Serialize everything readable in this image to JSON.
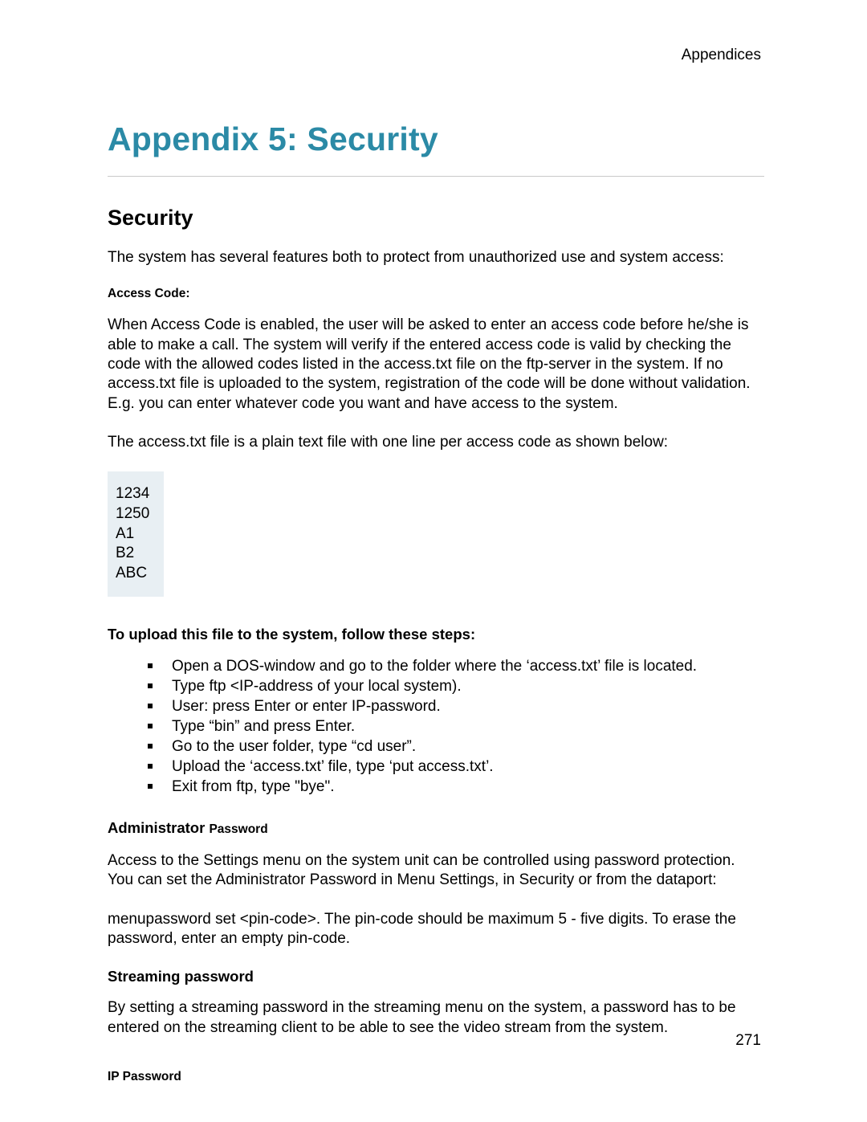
{
  "header": {
    "right": "Appendices"
  },
  "title": "Appendix 5: Security",
  "section_title": "Security",
  "intro": "The system has several features both to protect from unauthorized use and system access:",
  "access_code": {
    "heading": "Access Code:",
    "para1": "When Access Code is enabled, the user will be asked to enter an access code before he/she is able to make a call. The system will verify if the entered access code is valid by checking the code with the allowed codes listed in the access.txt file on the ftp-server in the system. If no access.txt file is uploaded to the system, registration of the code will be done without validation. E.g. you can enter whatever code you want and have access to the system.",
    "para2": "The access.txt file is a plain text file with one line per access code as shown below:",
    "codes": [
      "1234",
      "1250",
      "A1",
      "B2",
      "ABC"
    ]
  },
  "upload": {
    "heading": "To upload this file to the system, follow these steps:",
    "steps": [
      "Open a DOS-window and go to the folder where the ‘access.txt’ file is located.",
      "Type ftp <IP-address of your local system).",
      "User: press Enter or enter IP-password.",
      "Type “bin” and press Enter.",
      "Go to the user folder, type “cd user”.",
      "Upload the ‘access.txt’ file, type ‘put access.txt’.",
      "Exit from ftp, type \"bye\"."
    ]
  },
  "admin": {
    "heading_lg": "Administrator ",
    "heading_sm": "Password",
    "para1": "Access to the Settings menu on the system unit can be controlled using password protection. You can set the Administrator Password in Menu Settings, in Security or from the dataport:",
    "para2": "menupassword  set <pin-code>. The pin-code should be maximum 5 - five digits. To erase the password, enter an empty pin-code."
  },
  "streaming": {
    "heading": "Streaming password",
    "para": "By setting a streaming password in the streaming menu on the system, a password has to be entered on the streaming client to be able to see the video stream from the system."
  },
  "ip_password": {
    "heading": "IP Password"
  },
  "page_number": "271"
}
